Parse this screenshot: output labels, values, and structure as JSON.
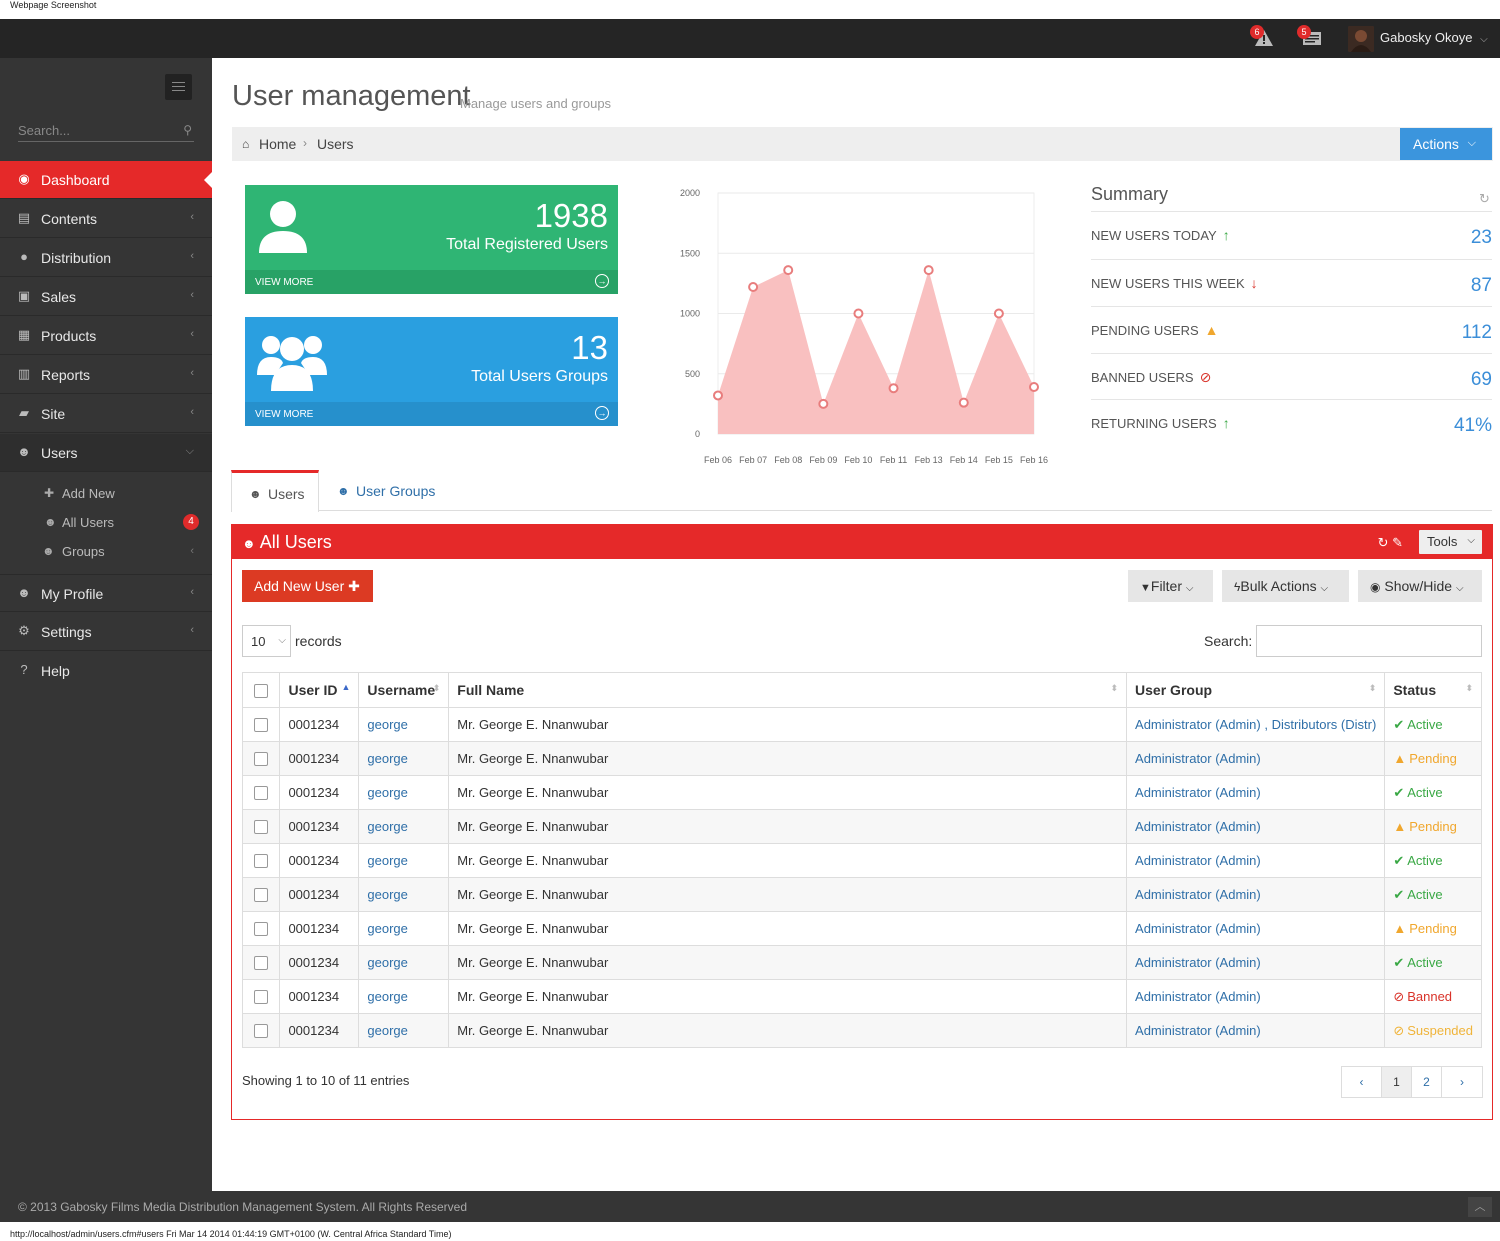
{
  "caption": {
    "top": "Webpage Screenshot",
    "bottom": "http://localhost/admin/users.cfm#users Fri Mar 14 2014 01:44:19 GMT+0100 (W. Central Africa Standard Time)"
  },
  "topbar": {
    "alerts_count": "6",
    "messages_count": "5",
    "user_name": "Gabosky Okoye"
  },
  "sidebar": {
    "search_placeholder": "Search...",
    "items": [
      {
        "label": "Dashboard",
        "icon": "dashboard-icon"
      },
      {
        "label": "Contents",
        "icon": "file-icon"
      },
      {
        "label": "Distribution",
        "icon": "globe-icon"
      },
      {
        "label": "Sales",
        "icon": "money-icon"
      },
      {
        "label": "Products",
        "icon": "briefcase-icon"
      },
      {
        "label": "Reports",
        "icon": "bar-chart-icon"
      },
      {
        "label": "Site",
        "icon": "folder-open-icon"
      },
      {
        "label": "Users",
        "icon": "users-icon"
      },
      {
        "label": "My Profile",
        "icon": "user-icon"
      },
      {
        "label": "Settings",
        "icon": "gears-icon"
      },
      {
        "label": "Help",
        "icon": "question-circle-icon"
      }
    ],
    "users_sub": [
      {
        "label": "Add New",
        "icon": "plus-icon"
      },
      {
        "label": "All Users",
        "icon": "user-icon",
        "badge": "4"
      },
      {
        "label": "Groups",
        "icon": "users-icon"
      }
    ]
  },
  "header": {
    "title": "User management",
    "subtitle": "Manage users and groups"
  },
  "breadcrumb": {
    "home": "Home",
    "current": "Users",
    "actions_label": "Actions"
  },
  "stats": [
    {
      "number": "1938",
      "label": "Total Registered Users",
      "view_more": "VIEW MORE",
      "color": "#2fb574"
    },
    {
      "number": "13",
      "label": "Total Users Groups",
      "view_more": "VIEW MORE",
      "color": "#2a9fe0"
    }
  ],
  "chart_data": {
    "type": "area",
    "categories": [
      "Feb 06",
      "Feb 07",
      "Feb 08",
      "Feb 09",
      "Feb 10",
      "Feb 11",
      "Feb 13",
      "Feb 14",
      "Feb 15",
      "Feb 16"
    ],
    "values": [
      320,
      1220,
      1360,
      250,
      1000,
      380,
      1360,
      260,
      1000,
      390
    ],
    "ylim": [
      0,
      2000
    ],
    "yticks": [
      "0",
      "500",
      "1000",
      "1500",
      "2000"
    ],
    "color": "#f9c0c0",
    "point_color": "#e87d7d",
    "grid": true
  },
  "summary": {
    "title": "Summary",
    "rows": [
      {
        "label": "NEW USERS TODAY",
        "indicator": "arrow-up-icon",
        "value": "23"
      },
      {
        "label": "NEW USERS THIS WEEK",
        "indicator": "arrow-down-icon",
        "value": "87"
      },
      {
        "label": "PENDING USERS",
        "indicator": "warning-icon",
        "value": "112"
      },
      {
        "label": "BANNED USERS",
        "indicator": "ban-icon",
        "value": "69"
      },
      {
        "label": "RETURNING USERS",
        "indicator": "arrow-up-icon",
        "value": "41%"
      }
    ]
  },
  "tabs": [
    {
      "label": "Users"
    },
    {
      "label": "User Groups"
    }
  ],
  "panel": {
    "title": "All Users",
    "tools_label": "Tools",
    "add_new_label": "Add New User",
    "filter_label": "Filter",
    "bulk_label": "Bulk Actions",
    "showhide_label": "Show/Hide",
    "records_value": "10",
    "records_label": "records",
    "search_label": "Search:",
    "columns": [
      "User ID",
      "Username",
      "Full Name",
      "User Group",
      "Status"
    ],
    "rows": [
      {
        "id": "0001234",
        "username": "george",
        "fullname": "Mr. George E. Nnanwubar",
        "group": "Administrator (Admin) , Distributors (Distr)",
        "status": "Active",
        "status_type": "active"
      },
      {
        "id": "0001234",
        "username": "george",
        "fullname": "Mr. George E. Nnanwubar",
        "group": "Administrator (Admin)",
        "status": "Pending",
        "status_type": "pending"
      },
      {
        "id": "0001234",
        "username": "george",
        "fullname": "Mr. George E. Nnanwubar",
        "group": "Administrator (Admin)",
        "status": "Active",
        "status_type": "active"
      },
      {
        "id": "0001234",
        "username": "george",
        "fullname": "Mr. George E. Nnanwubar",
        "group": "Administrator (Admin)",
        "status": "Pending",
        "status_type": "pending"
      },
      {
        "id": "0001234",
        "username": "george",
        "fullname": "Mr. George E. Nnanwubar",
        "group": "Administrator (Admin)",
        "status": "Active",
        "status_type": "active"
      },
      {
        "id": "0001234",
        "username": "george",
        "fullname": "Mr. George E. Nnanwubar",
        "group": "Administrator (Admin)",
        "status": "Active",
        "status_type": "active"
      },
      {
        "id": "0001234",
        "username": "george",
        "fullname": "Mr. George E. Nnanwubar",
        "group": "Administrator (Admin)",
        "status": "Pending",
        "status_type": "pending"
      },
      {
        "id": "0001234",
        "username": "george",
        "fullname": "Mr. George E. Nnanwubar",
        "group": "Administrator (Admin)",
        "status": "Active",
        "status_type": "active"
      },
      {
        "id": "0001234",
        "username": "george",
        "fullname": "Mr. George E. Nnanwubar",
        "group": "Administrator (Admin)",
        "status": "Banned",
        "status_type": "banned"
      },
      {
        "id": "0001234",
        "username": "george",
        "fullname": "Mr. George E. Nnanwubar",
        "group": "Administrator (Admin)",
        "status": "Suspended",
        "status_type": "suspended"
      }
    ],
    "showing": "Showing 1 to 10 of 11 entries",
    "pages": [
      "‹",
      "1",
      "2",
      "›"
    ]
  },
  "footer": {
    "text": "© 2013 Gabosky Films Media Distribution Management System. All Rights Reserved"
  }
}
